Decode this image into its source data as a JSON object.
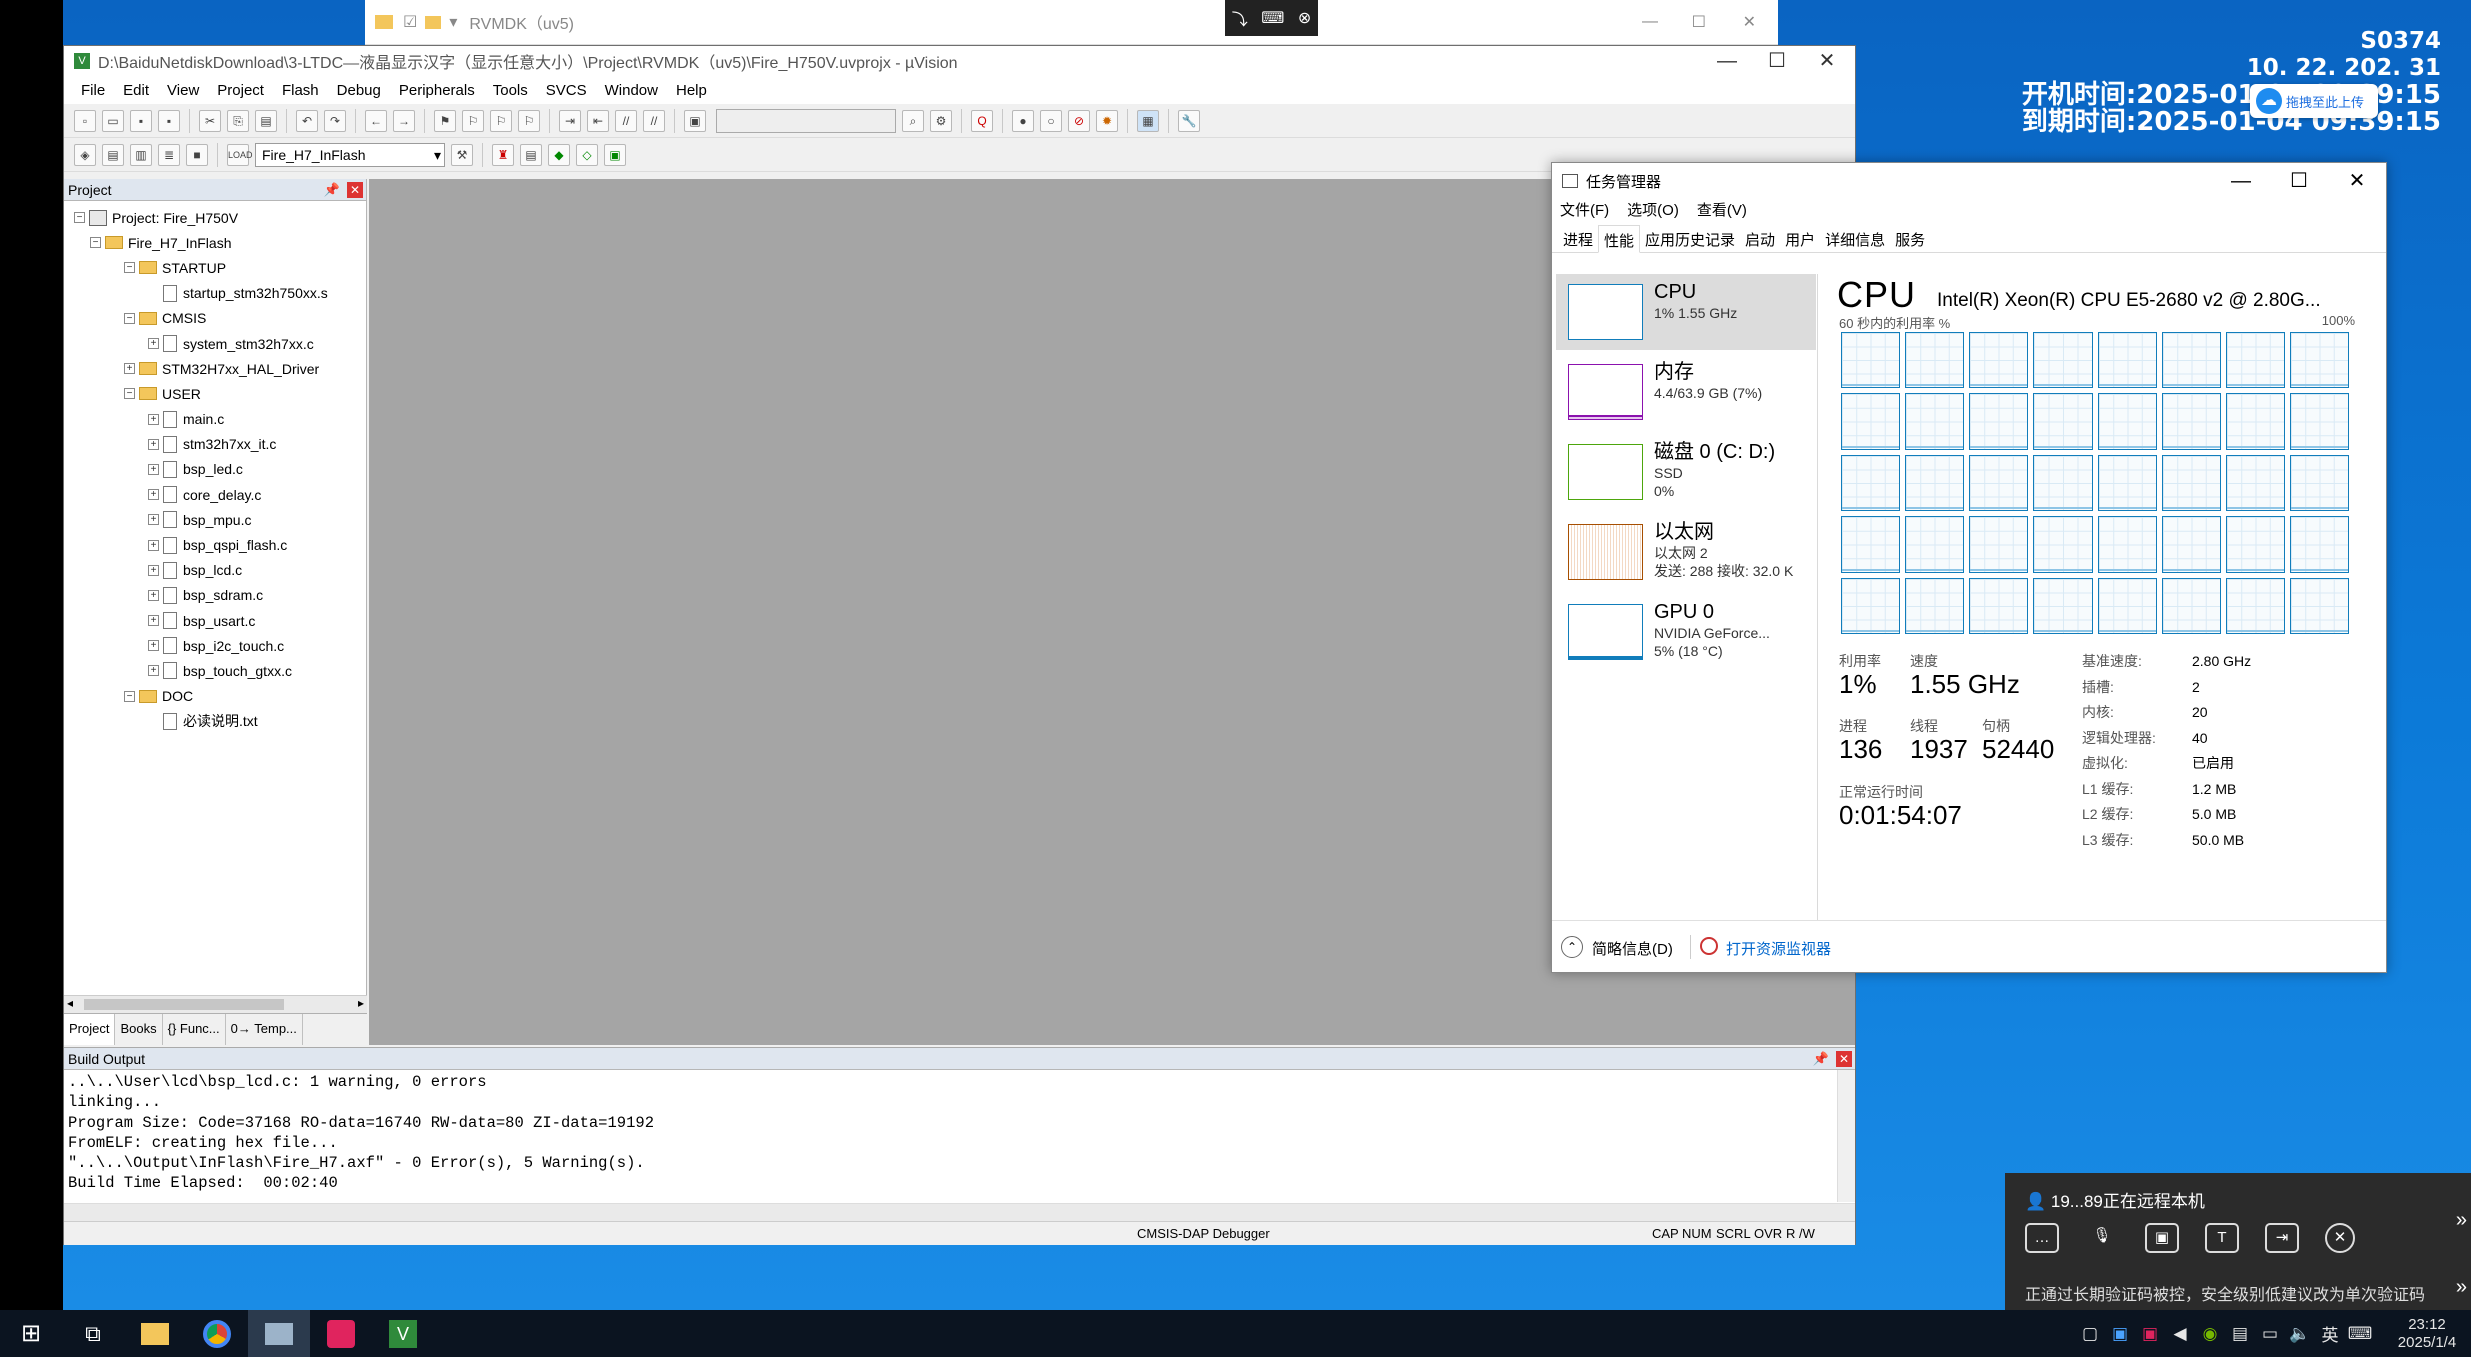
{
  "remote_info": {
    "host": "S0374",
    "ip": "10. 22. 202. 31",
    "boot_label": "开机时间:2025",
    "boot_time": "-01-04 09:39:15",
    "expire_label": "到期时间:2025",
    "expire_time": "-01-04 09:39:15",
    "baidu_btn": "拖拽至此上传"
  },
  "explorer": {
    "title": "RVMDK（uv5)"
  },
  "uvision": {
    "title": "D:\\BaiduNetdiskDownload\\3-LTDC—液晶显示汉字（显示任意大小）\\Project\\RVMDK（uv5)\\Fire_H750V.uvprojx - µVision",
    "menu": [
      "File",
      "Edit",
      "View",
      "Project",
      "Flash",
      "Debug",
      "Peripherals",
      "Tools",
      "SVCS",
      "Window",
      "Help"
    ],
    "target": "Fire_H7_InFlash",
    "project_panel_title": "Project",
    "tree": [
      {
        "level": 0,
        "type": "proj",
        "text": "Project: Fire_H750V"
      },
      {
        "level": 1,
        "type": "target",
        "text": "Fire_H7_InFlash"
      },
      {
        "level": 2,
        "type": "folder",
        "text": "STARTUP"
      },
      {
        "level": 3,
        "type": "file",
        "text": "startup_stm32h750xx.s"
      },
      {
        "level": 2,
        "type": "folder",
        "text": "CMSIS"
      },
      {
        "level": 3,
        "type": "file",
        "text": "system_stm32h7xx.c"
      },
      {
        "level": 2,
        "type": "folder",
        "text": "STM32H7xx_HAL_Driver"
      },
      {
        "level": 2,
        "type": "folder",
        "text": "USER"
      },
      {
        "level": 3,
        "type": "file",
        "text": "main.c"
      },
      {
        "level": 3,
        "type": "file",
        "text": "stm32h7xx_it.c"
      },
      {
        "level": 3,
        "type": "file",
        "text": "bsp_led.c"
      },
      {
        "level": 3,
        "type": "file",
        "text": "core_delay.c"
      },
      {
        "level": 3,
        "type": "file",
        "text": "bsp_mpu.c"
      },
      {
        "level": 3,
        "type": "file",
        "text": "bsp_qspi_flash.c"
      },
      {
        "level": 3,
        "type": "file",
        "text": "bsp_lcd.c"
      },
      {
        "level": 3,
        "type": "file",
        "text": "bsp_sdram.c"
      },
      {
        "level": 3,
        "type": "file",
        "text": "bsp_usart.c"
      },
      {
        "level": 3,
        "type": "file",
        "text": "bsp_i2c_touch.c"
      },
      {
        "level": 3,
        "type": "file",
        "text": "bsp_touch_gtxx.c"
      },
      {
        "level": 2,
        "type": "folder",
        "text": "DOC"
      },
      {
        "level": 3,
        "type": "file",
        "text": "必读说明.txt"
      }
    ],
    "panel_tabs": [
      "Project",
      "Books",
      "{} Func...",
      "0→ Temp..."
    ],
    "build_title": "Build Output",
    "build_lines": "..\\..\\User\\lcd\\bsp_lcd.c: 1 warning, 0 errors\nlinking...\nProgram Size: Code=37168 RO-data=16740 RW-data=80 ZI-data=19192\nFromELF: creating hex file...\n\"..\\..\\Output\\InFlash\\Fire_H7.axf\" - 0 Error(s), 5 Warning(s).\nBuild Time Elapsed:  00:02:40",
    "status": {
      "debugger": "CMSIS-DAP Debugger",
      "cap": "CAP",
      "num": "NUM",
      "scrl": "SCRL",
      "ovr": "OVR",
      "rw": "R /W"
    }
  },
  "taskmgr": {
    "title": "任务管理器",
    "menu": [
      "文件(F)",
      "选项(O)",
      "查看(V)"
    ],
    "tabs": [
      "进程",
      "性能",
      "应用历史记录",
      "启动",
      "用户",
      "详细信息",
      "服务"
    ],
    "side": [
      {
        "name": "CPU",
        "l2": "1% 1.55 GHz",
        "l3": ""
      },
      {
        "name": "内存",
        "l2": "4.4/63.9 GB (7%)",
        "l3": ""
      },
      {
        "name": "磁盘 0 (C: D:)",
        "l2": "SSD",
        "l3": "0%"
      },
      {
        "name": "以太网",
        "l2": "以太网 2",
        "l3": "发送: 288 接收: 32.0 K"
      },
      {
        "name": "GPU 0",
        "l2": "NVIDIA GeForce...",
        "l3": "5% (18 °C)"
      }
    ],
    "cpu_head": "CPU",
    "cpu_model": "Intel(R) Xeon(R) CPU E5-2680 v2 @ 2.80G...",
    "graph_label": "60 秒内的利用率 %",
    "graph_max": "100%",
    "util_label": "利用率",
    "util": "1%",
    "speed_label": "速度",
    "speed": "1.55 GHz",
    "proc_label": "进程",
    "proc": "136",
    "thread_label": "线程",
    "thread": "1937",
    "handle_label": "句柄",
    "handle": "52440",
    "uptime_label": "正常运行时间",
    "uptime": "0:01:54:07",
    "specs": [
      {
        "k": "基准速度:",
        "v": "2.80 GHz"
      },
      {
        "k": "插槽:",
        "v": "2"
      },
      {
        "k": "内核:",
        "v": "20"
      },
      {
        "k": "逻辑处理器:",
        "v": "40"
      },
      {
        "k": "虚拟化:",
        "v": "已启用"
      },
      {
        "k": "L1 缓存:",
        "v": "1.2 MB"
      },
      {
        "k": "L2 缓存:",
        "v": "5.0 MB"
      },
      {
        "k": "L3 缓存:",
        "v": "50.0 MB"
      }
    ],
    "less_details": "简略信息(D)",
    "resmon": "打开资源监视器"
  },
  "remote_popup": {
    "user": "19...89正在远程本机",
    "notice": "正通过长期验证码被控，安全级别低建议改为单次验证码"
  },
  "taskbar": {
    "time": "23:12",
    "date": "2025/1/4",
    "ime": "英"
  },
  "colors": {
    "accent_blue": "#117dbb",
    "desktop": "#0b6fc7"
  }
}
